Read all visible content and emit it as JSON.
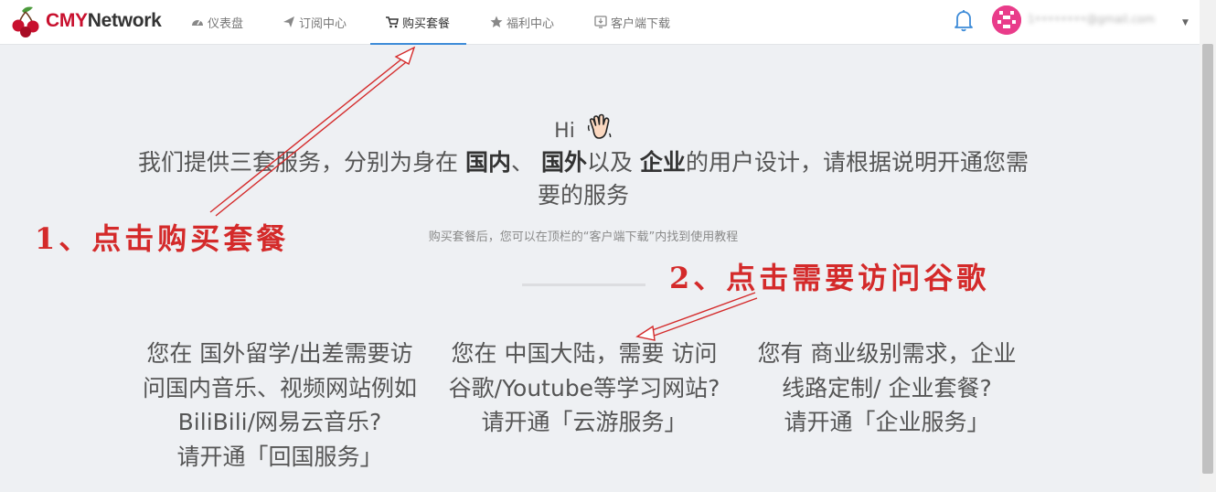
{
  "brand": {
    "name_part1": "CMY",
    "name_part2": "Network"
  },
  "nav": [
    {
      "label": "仪表盘",
      "icon": "dashboard-icon"
    },
    {
      "label": "订阅中心",
      "icon": "send-icon"
    },
    {
      "label": "购买套餐",
      "icon": "cart-icon",
      "active": true
    },
    {
      "label": "福利中心",
      "icon": "star-icon"
    },
    {
      "label": "客户端下载",
      "icon": "download-icon"
    }
  ],
  "user": {
    "email": "1••••••••@gmail.com"
  },
  "hero": {
    "hi": "Hi",
    "intro_1": "我们提供三套服务，分别为身在 ",
    "intro_domestic": "国内",
    "intro_2": "、 ",
    "intro_abroad": "国外",
    "intro_3": "以及 ",
    "intro_enterprise": "企业",
    "intro_4": "的用户设计，请根据说明开通您需要的服务",
    "tip": "购买套餐后，您可以在顶栏的“客户端下载”内找到使用教程"
  },
  "services": [
    {
      "text": "您在 国外留学/出差需要访问国内音乐、视频网站例如BiliBili/网易云音乐?",
      "cta": "请开通「回国服务」"
    },
    {
      "text": "您在 中国大陆，需要 访问谷歌/Youtube等学习网站?",
      "cta": "请开通「云游服务」"
    },
    {
      "text": "您有 商业级别需求，企业线路定制/ 企业套餐?",
      "cta": "请开通「企业服务」"
    }
  ],
  "annotations": {
    "step1": "1、点击购买套餐",
    "step2": "2、点击需要访问谷歌"
  },
  "colors": {
    "brand_red": "#c8102e",
    "nav_active": "#3d8bd8",
    "annotation_red": "#d42a2a",
    "avatar": "#e93c8a"
  }
}
